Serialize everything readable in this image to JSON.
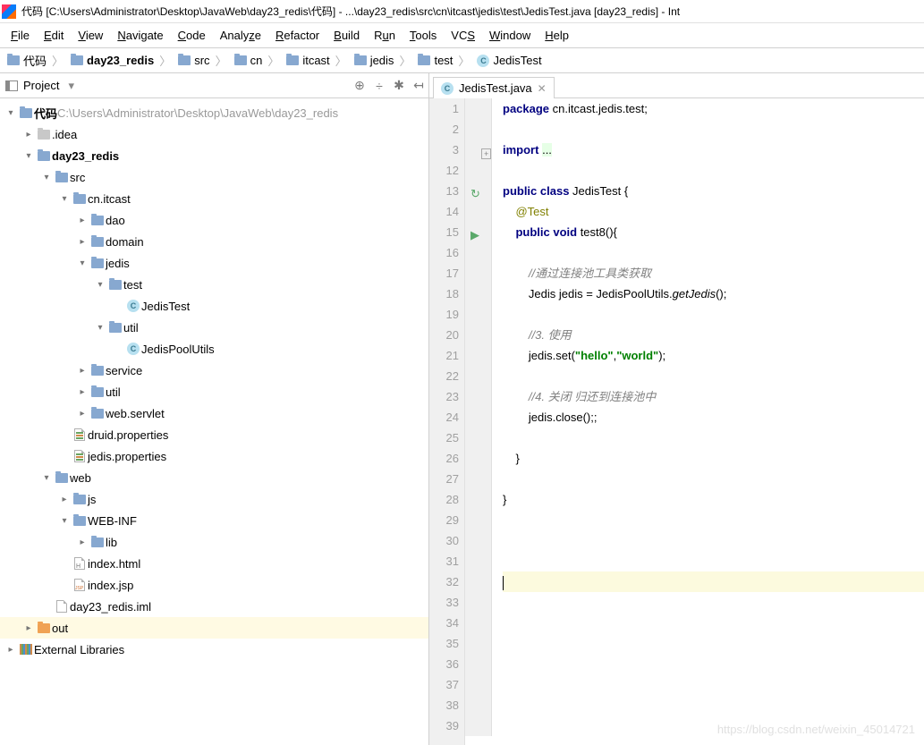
{
  "title": "代码 [C:\\Users\\Administrator\\Desktop\\JavaWeb\\day23_redis\\代码] - ...\\day23_redis\\src\\cn\\itcast\\jedis\\test\\JedisTest.java [day23_redis] - Int",
  "menu": [
    {
      "u": "F",
      "rest": "ile"
    },
    {
      "u": "E",
      "rest": "dit"
    },
    {
      "u": "V",
      "rest": "iew"
    },
    {
      "u": "N",
      "rest": "avigate"
    },
    {
      "u": "C",
      "rest": "ode"
    },
    {
      "u": "",
      "rest": "Analy",
      "u2": "z",
      "rest2": "e"
    },
    {
      "u": "R",
      "rest": "efactor"
    },
    {
      "u": "B",
      "rest": "uild"
    },
    {
      "u": "",
      "rest": "R",
      "u2": "u",
      "rest2": "n"
    },
    {
      "u": "T",
      "rest": "ools"
    },
    {
      "u": "",
      "rest": "VC",
      "u2": "S",
      "rest2": ""
    },
    {
      "u": "W",
      "rest": "indow"
    },
    {
      "u": "H",
      "rest": "elp"
    }
  ],
  "breadcrumb": [
    {
      "icon": "folder",
      "label": "代码"
    },
    {
      "icon": "folder",
      "label": "day23_redis",
      "bold": true
    },
    {
      "icon": "folder",
      "label": "src"
    },
    {
      "icon": "folder",
      "label": "cn"
    },
    {
      "icon": "folder",
      "label": "itcast"
    },
    {
      "icon": "folder",
      "label": "jedis"
    },
    {
      "icon": "folder",
      "label": "test"
    },
    {
      "icon": "class",
      "label": "JedisTest"
    }
  ],
  "project_header": {
    "label": "Project",
    "icons": [
      "⊕",
      "÷",
      "✱",
      "↤"
    ]
  },
  "tree": [
    {
      "d": 0,
      "a": "v",
      "i": "folder",
      "t": "代码",
      "path": " C:\\Users\\Administrator\\Desktop\\JavaWeb\\day23_redis",
      "bold": true
    },
    {
      "d": 1,
      "a": ">",
      "i": "folder-muted",
      "t": ".idea"
    },
    {
      "d": 1,
      "a": "v",
      "i": "folder",
      "t": "day23_redis",
      "bold": true
    },
    {
      "d": 2,
      "a": "v",
      "i": "folder",
      "t": "src"
    },
    {
      "d": 3,
      "a": "v",
      "i": "folder",
      "t": "cn.itcast"
    },
    {
      "d": 4,
      "a": ">",
      "i": "folder",
      "t": "dao"
    },
    {
      "d": 4,
      "a": ">",
      "i": "folder",
      "t": "domain"
    },
    {
      "d": 4,
      "a": "v",
      "i": "folder",
      "t": "jedis"
    },
    {
      "d": 5,
      "a": "v",
      "i": "folder",
      "t": "test"
    },
    {
      "d": 6,
      "a": "",
      "i": "class",
      "t": "JedisTest"
    },
    {
      "d": 5,
      "a": "v",
      "i": "folder",
      "t": "util"
    },
    {
      "d": 6,
      "a": "",
      "i": "class",
      "t": "JedisPoolUtils"
    },
    {
      "d": 4,
      "a": ">",
      "i": "folder",
      "t": "service"
    },
    {
      "d": 4,
      "a": ">",
      "i": "folder",
      "t": "util"
    },
    {
      "d": 4,
      "a": ">",
      "i": "folder",
      "t": "web.servlet"
    },
    {
      "d": 3,
      "a": "",
      "i": "props",
      "t": "druid.properties"
    },
    {
      "d": 3,
      "a": "",
      "i": "props",
      "t": "jedis.properties"
    },
    {
      "d": 2,
      "a": "v",
      "i": "folder",
      "t": "web"
    },
    {
      "d": 3,
      "a": ">",
      "i": "folder",
      "t": "js"
    },
    {
      "d": 3,
      "a": "v",
      "i": "folder",
      "t": "WEB-INF"
    },
    {
      "d": 4,
      "a": ">",
      "i": "folder",
      "t": "lib"
    },
    {
      "d": 3,
      "a": "",
      "i": "html",
      "t": "index.html"
    },
    {
      "d": 3,
      "a": "",
      "i": "jsp",
      "t": "index.jsp"
    },
    {
      "d": 2,
      "a": "",
      "i": "file",
      "t": "day23_redis.iml"
    },
    {
      "d": 1,
      "a": ">",
      "i": "folder-orange",
      "t": "out",
      "hl": true
    },
    {
      "d": 0,
      "a": ">",
      "i": "lib",
      "t": "External Libraries"
    }
  ],
  "tab": {
    "label": "JedisTest.java"
  },
  "code": {
    "lines": [
      {
        "n": 1,
        "h": "<span class='kw'>package</span> cn.itcast.jedis.test;"
      },
      {
        "n": 2,
        "h": ""
      },
      {
        "n": 3,
        "h": "<span class='kw'>import</span> <span class='imp-bg'>...</span>",
        "fold": "+"
      },
      {
        "n": 12,
        "h": ""
      },
      {
        "n": 13,
        "h": "<span class='kw'>public class</span> JedisTest {",
        "mark": "↻"
      },
      {
        "n": 14,
        "h": "    <span class='ann'>@Test</span>"
      },
      {
        "n": 15,
        "h": "    <span class='kw'>public void</span> test8(){",
        "mark": "▶"
      },
      {
        "n": 16,
        "h": ""
      },
      {
        "n": 17,
        "h": "        <span class='cm'>//通过连接池工具类获取</span>"
      },
      {
        "n": 18,
        "h": "        Jedis jedis = JedisPoolUtils.<span class='mtd-i'>getJedis</span>();"
      },
      {
        "n": 19,
        "h": ""
      },
      {
        "n": 20,
        "h": "        <span class='cm'>//3. 使用</span>"
      },
      {
        "n": 21,
        "h": "        jedis.set(<span class='str'>\"hello\"</span>,<span class='str'>\"world\"</span>);"
      },
      {
        "n": 22,
        "h": ""
      },
      {
        "n": 23,
        "h": "        <span class='cm'>//4. 关闭 归还到连接池中</span>"
      },
      {
        "n": 24,
        "h": "        jedis.close();;"
      },
      {
        "n": 25,
        "h": ""
      },
      {
        "n": 26,
        "h": "    }"
      },
      {
        "n": 27,
        "h": ""
      },
      {
        "n": 28,
        "h": "}"
      },
      {
        "n": 29,
        "h": ""
      },
      {
        "n": 30,
        "h": ""
      },
      {
        "n": 31,
        "h": ""
      },
      {
        "n": 32,
        "h": "<span class='caret'></span>",
        "hl": true
      },
      {
        "n": 33,
        "h": ""
      },
      {
        "n": 34,
        "h": ""
      },
      {
        "n": 35,
        "h": ""
      },
      {
        "n": 36,
        "h": ""
      },
      {
        "n": 37,
        "h": ""
      },
      {
        "n": 38,
        "h": ""
      },
      {
        "n": 39,
        "h": ""
      }
    ]
  },
  "watermark": "https://blog.csdn.net/weixin_45014721"
}
